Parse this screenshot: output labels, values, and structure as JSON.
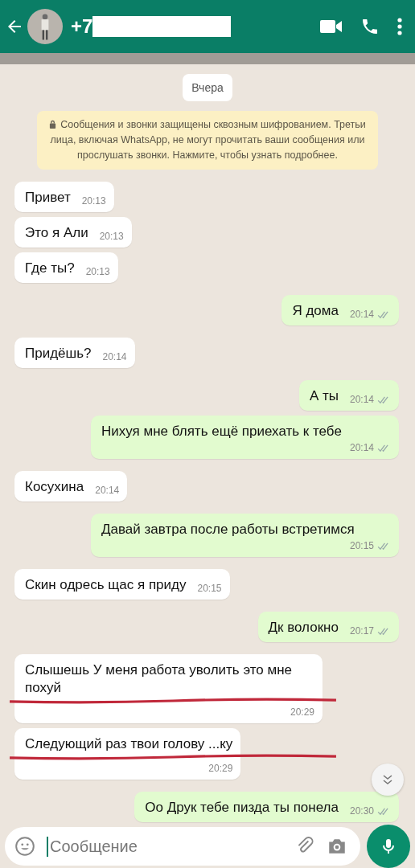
{
  "header": {
    "title": "+7",
    "redacted": true
  },
  "date_chip": "Вчера",
  "notice": "Сообщения и звонки защищены сквозным шифрованием. Третьи лица, включая WhatsApp, не могут прочитать ваши сообщения или прослушать звонки. Нажмите, чтобы узнать подробнее.",
  "messages": [
    {
      "kind": "in",
      "text": "Привет",
      "time": "20:13",
      "underlined": false
    },
    {
      "kind": "in",
      "text": "Это я Али",
      "time": "20:13",
      "underlined": false
    },
    {
      "kind": "in",
      "text": "Где ты?",
      "time": "20:13",
      "underlined": false
    },
    {
      "kind": "out",
      "text": "Я дома",
      "time": "20:14",
      "underlined": false
    },
    {
      "kind": "in",
      "text": "Придёшь?",
      "time": "20:14",
      "underlined": false
    },
    {
      "kind": "out",
      "text": "А ты",
      "time": "20:14",
      "underlined": false
    },
    {
      "kind": "out",
      "text": "Нихуя мне блять ещё приехать к тебе",
      "time": "20:14",
      "underlined": false
    },
    {
      "kind": "in",
      "text": "Косухина",
      "time": "20:14",
      "underlined": false
    },
    {
      "kind": "out",
      "text": "Давай завтра после работы встретимся",
      "time": "20:15",
      "underlined": false
    },
    {
      "kind": "in",
      "text": "Скин одресь  щас я приду",
      "time": "20:15",
      "underlined": false
    },
    {
      "kind": "out",
      "text": "Дк волокно",
      "time": "20:17",
      "underlined": false
    },
    {
      "kind": "in",
      "text": "Слышешь  У меня   работа уволить  это мне похуй",
      "time": "20:29",
      "underlined": true
    },
    {
      "kind": "in",
      "text": "Следующий раз   твои голову  ...ку",
      "time": "20:29",
      "underlined": true
    },
    {
      "kind": "out",
      "text": "Оо Друк тебе пизда ты понела",
      "time": "20:30",
      "underlined": false
    }
  ],
  "composer": {
    "placeholder": "Сообщение"
  }
}
